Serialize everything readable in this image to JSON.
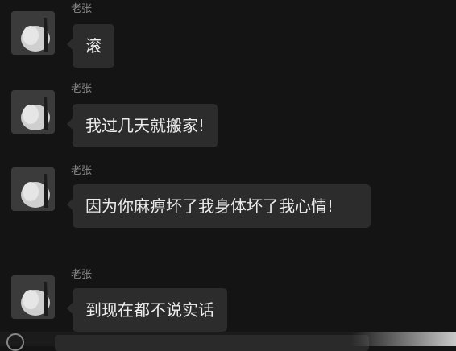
{
  "messages": [
    {
      "sender": "老张",
      "text": "滚"
    },
    {
      "sender": "老张",
      "text": "我过几天就搬家!"
    },
    {
      "sender": "老张",
      "text": "因为你麻痹坏了我身体坏了我心情!"
    },
    {
      "sender": "老张",
      "text": "到现在都不说实话"
    }
  ],
  "colors": {
    "background": "#141414",
    "bubble": "#2c2c2c",
    "text": "#ececec",
    "sender": "#8a8a8a"
  }
}
